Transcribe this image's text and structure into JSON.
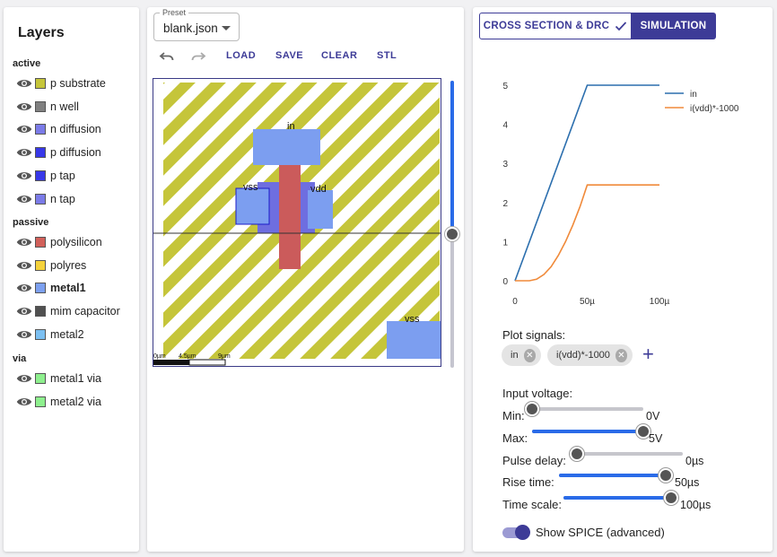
{
  "layers": {
    "title": "Layers",
    "groups": [
      {
        "name": "active",
        "items": [
          {
            "label": "p substrate",
            "color": "#c5c53a"
          },
          {
            "label": "n well",
            "color": "#808080"
          },
          {
            "label": "n diffusion",
            "color": "#7b7be8"
          },
          {
            "label": "p diffusion",
            "color": "#3838e8"
          },
          {
            "label": "p tap",
            "color": "#3838e8"
          },
          {
            "label": "n tap",
            "color": "#7b7be8"
          }
        ]
      },
      {
        "name": "passive",
        "items": [
          {
            "label": "polysilicon",
            "color": "#d1605a"
          },
          {
            "label": "polyres",
            "color": "#f5d23c"
          },
          {
            "label": "metal1",
            "color": "#7ca0f0",
            "active": true
          },
          {
            "label": "mim capacitor",
            "color": "#505050"
          },
          {
            "label": "metal2",
            "color": "#7cc0f2"
          }
        ]
      },
      {
        "name": "via",
        "items": [
          {
            "label": "metal1 via",
            "color": "#8ef08e"
          },
          {
            "label": "metal2 via",
            "color": "#8ef08e"
          }
        ]
      }
    ]
  },
  "layout": {
    "preset_label": "Preset",
    "preset_value": "blank.json",
    "toolbar": {
      "undo": "undo-icon",
      "redo": "redo-icon",
      "load": "LOAD",
      "save": "SAVE",
      "clear": "CLEAR",
      "stl": "STL"
    },
    "canvas": {
      "label_in": "in",
      "label_vss_top": "vss",
      "label_vdd": "vdd",
      "label_vss_bottom": "vss",
      "scale_labels": [
        "0µm",
        "4.5µm",
        "9µm"
      ]
    }
  },
  "simulation": {
    "tab_cross_section": "CROSS SECTION & DRC",
    "tab_simulation": "SIMULATION",
    "plot_signals_label": "Plot signals:",
    "signals": [
      "in",
      "i(vdd)*-1000"
    ],
    "input_voltage_label": "Input voltage:",
    "sliders": [
      {
        "label": "Min:",
        "value": "0V",
        "fraction": 0.0
      },
      {
        "label": "Max:",
        "value": "5V",
        "fraction": 1.0
      },
      {
        "label": "Pulse delay:",
        "value": "0µs",
        "fraction": 0.0
      },
      {
        "label": "Rise time:",
        "value": "50µs",
        "fraction": 1.0
      },
      {
        "label": "Time scale:",
        "value": "100µs",
        "fraction": 1.0
      }
    ],
    "show_spice_label": "Show SPICE (advanced)",
    "show_spice_on": true
  },
  "chart_data": {
    "type": "line",
    "x_tick_labels": [
      "0",
      "50µ",
      "100µ"
    ],
    "y_tick_labels": [
      "0",
      "1",
      "2",
      "3",
      "4",
      "5"
    ],
    "xlim": [
      0,
      0.0001
    ],
    "ylim": [
      0,
      5
    ],
    "legend_position": "top-right",
    "series": [
      {
        "name": "in",
        "color": "#2c6fae",
        "x": [
          0,
          5e-05,
          0.0001
        ],
        "y": [
          0,
          5,
          5
        ]
      },
      {
        "name": "i(vdd)*-1000",
        "color": "#f08a3a",
        "x": [
          0,
          1e-05,
          1.5e-05,
          2e-05,
          2.5e-05,
          3e-05,
          3.5e-05,
          4e-05,
          4.5e-05,
          5e-05,
          6e-05,
          8e-05,
          0.0001
        ],
        "y": [
          0,
          0,
          0.04,
          0.16,
          0.36,
          0.65,
          1.0,
          1.42,
          1.9,
          2.45,
          2.45,
          2.45,
          2.45
        ]
      }
    ]
  }
}
